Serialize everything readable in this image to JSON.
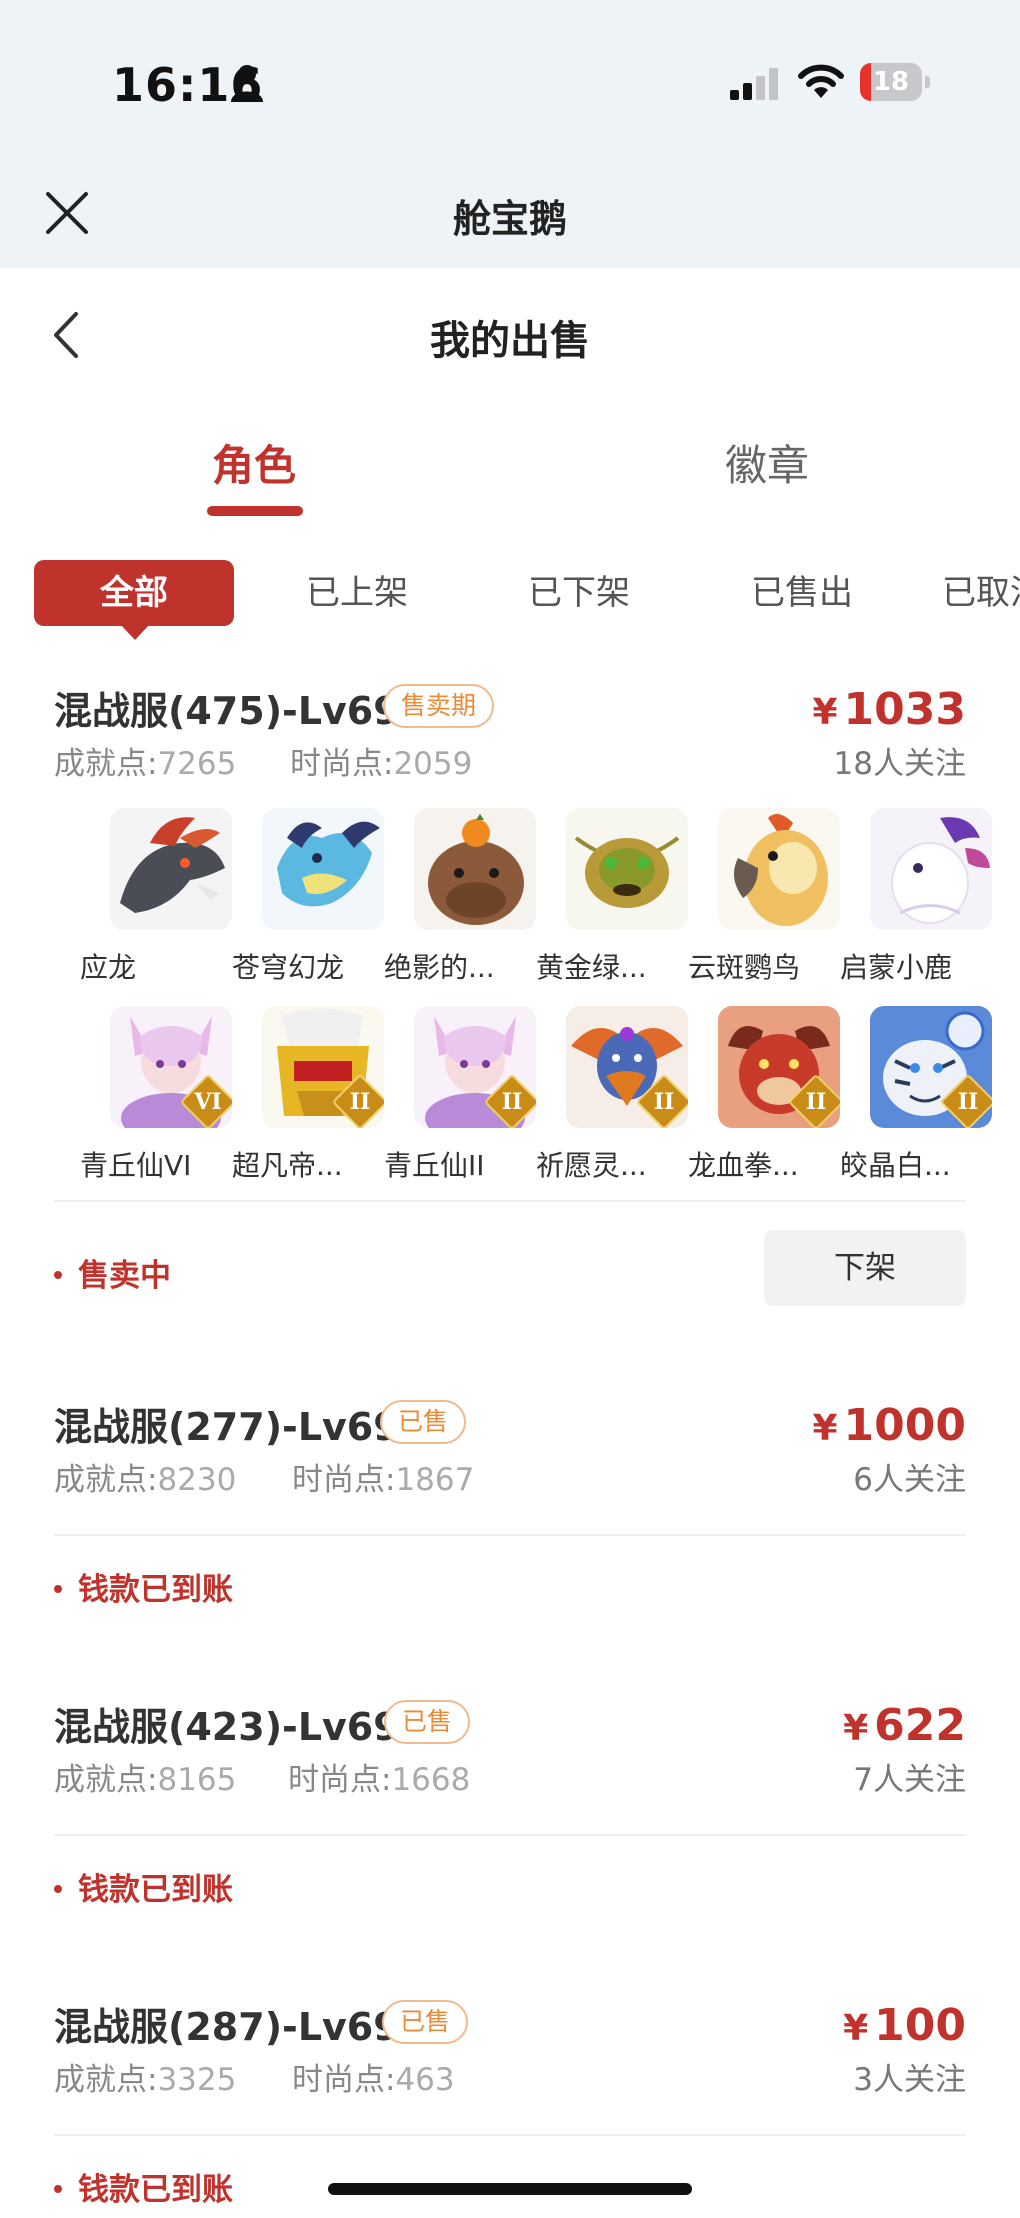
{
  "status_bar": {
    "time": "16:16",
    "battery": "18",
    "battery_level": 0.18
  },
  "app_bar": {
    "title": "舱宝鹅"
  },
  "page": {
    "title": "我的出售"
  },
  "main_tabs": [
    {
      "label": "角色",
      "active": true
    },
    {
      "label": "徽章",
      "active": false
    }
  ],
  "filters": [
    {
      "label": "全部",
      "active": true
    },
    {
      "label": "已上架",
      "active": false
    },
    {
      "label": "已下架",
      "active": false
    },
    {
      "label": "已售出",
      "active": false
    },
    {
      "label": "已取消",
      "active": false
    }
  ],
  "listings": [
    {
      "title": "混战服(475)-Lv69",
      "badge": "售卖期",
      "currency": "¥",
      "price": "1033",
      "achievement_label": "成就点:",
      "achievement": "7265",
      "fashion_label": "时尚点:",
      "fashion": "2059",
      "followers": "18人关注",
      "status": "售卖中",
      "action": "下架",
      "pets": [
        {
          "name": "应龙",
          "icon": "dark-dragon-icon"
        },
        {
          "name": "苍穹幻龙",
          "icon": "sky-dragon-icon"
        },
        {
          "name": "绝影的...",
          "icon": "capybara-icon"
        },
        {
          "name": "黄金绿...",
          "icon": "golden-beetle-icon"
        },
        {
          "name": "云斑鹦鸟",
          "icon": "parrot-icon"
        },
        {
          "name": "启蒙小鹿",
          "icon": "white-deer-icon"
        },
        {
          "name": "青丘仙VI",
          "icon": "fox-fairy-icon",
          "tier": "VI"
        },
        {
          "name": "超凡帝...",
          "icon": "golden-armor-icon",
          "tier": "II"
        },
        {
          "name": "青丘仙II",
          "icon": "fox-fairy-icon",
          "tier": "II"
        },
        {
          "name": "祈愿灵...",
          "icon": "griffin-icon",
          "tier": "II"
        },
        {
          "name": "龙血拳...",
          "icon": "red-beast-icon",
          "tier": "II"
        },
        {
          "name": "皎晶白...",
          "icon": "white-tiger-icon",
          "tier": "II"
        }
      ]
    },
    {
      "title": "混战服(277)-Lv69",
      "badge": "已售",
      "currency": "¥",
      "price": "1000",
      "achievement_label": "成就点:",
      "achievement": "8230",
      "fashion_label": "时尚点:",
      "fashion": "1867",
      "followers": "6人关注",
      "status": "钱款已到账"
    },
    {
      "title": "混战服(423)-Lv69",
      "badge": "已售",
      "currency": "¥",
      "price": "622",
      "achievement_label": "成就点:",
      "achievement": "8165",
      "fashion_label": "时尚点:",
      "fashion": "1668",
      "followers": "7人关注",
      "status": "钱款已到账"
    },
    {
      "title": "混战服(287)-Lv69",
      "badge": "已售",
      "currency": "¥",
      "price": "100",
      "achievement_label": "成就点:",
      "achievement": "3325",
      "fashion_label": "时尚点:",
      "fashion": "463",
      "followers": "3人关注",
      "status": "钱款已到账"
    }
  ],
  "colors": {
    "accent": "#c0332d",
    "badge": "#ec8a36",
    "top_bar_bg": "#eef3f7"
  }
}
